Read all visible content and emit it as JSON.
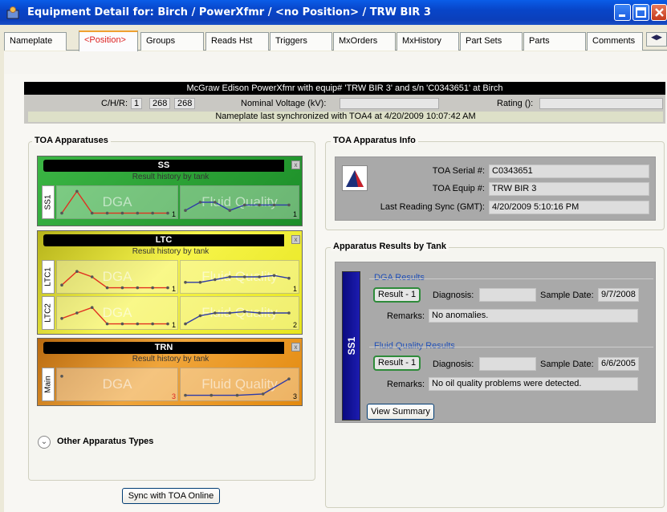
{
  "window": {
    "title": "Equipment Detail for:  Birch / PowerXfmr / <no Position> / TRW BIR 3"
  },
  "tabs": [
    "Nameplate",
    "<Position>",
    "Groups",
    "Reads Hst",
    "Triggers",
    "MxOrders",
    "MxHistory",
    "Part Sets",
    "Parts",
    "Comments"
  ],
  "nameplate": {
    "header": "McGraw Edison PowerXfmr with equip# 'TRW BIR 3' and s/n 'C0343651' at Birch",
    "chr_label": "C/H/R:",
    "chr_values": [
      "1",
      "268",
      "268"
    ],
    "voltage_label": "Nominal Voltage (kV):",
    "voltage_value": "",
    "rating_label": "Rating ():",
    "rating_value": "",
    "sync_text": "Nameplate last synchronized with TOA4 at 4/20/2009 10:07:42 AM"
  },
  "toa_apparatuses": {
    "title": "TOA Apparatuses",
    "subtitle": "Result history by tank",
    "dga_watermark": "DGA",
    "fq_watermark": "Fluid Quality",
    "close": "x",
    "groups": [
      {
        "name": "SS",
        "color": "#1f9c2c",
        "tanks": [
          {
            "label": "SS1",
            "dga_count": "1",
            "fq_count": "1",
            "dga_points": [
              0.9,
              0.1,
              0.9,
              0.9,
              0.9,
              0.9,
              0.9,
              0.9
            ],
            "fq_points": [
              0.8,
              0.5,
              0.5,
              0.8,
              0.6,
              0.6,
              0.6,
              0.6
            ]
          }
        ]
      },
      {
        "name": "LTC",
        "color": "#e2e012",
        "tanks": [
          {
            "label": "LTC1",
            "dga_count": "1",
            "fq_count": "1",
            "dga_points": [
              0.8,
              0.3,
              0.5,
              0.9,
              0.9,
              0.9,
              0.9,
              0.9
            ],
            "fq_points": [
              0.7,
              0.7,
              0.6,
              0.5,
              0.5,
              0.5,
              0.45,
              0.55
            ]
          },
          {
            "label": "LTC2",
            "dga_count": "1",
            "fq_count": "2",
            "dga_points": [
              0.7,
              0.5,
              0.3,
              0.9,
              0.9,
              0.9,
              0.9,
              0.9
            ],
            "fq_points": [
              0.9,
              0.6,
              0.5,
              0.5,
              0.45,
              0.5,
              0.5,
              0.5
            ]
          }
        ]
      },
      {
        "name": "TRN",
        "color": "#e38a0f",
        "tanks": [
          {
            "label": "Main",
            "dga_count": "3",
            "fq_count": "3",
            "dga_points": [
              0.2
            ],
            "fq_points": [
              0.9,
              0.9,
              0.9,
              0.85,
              0.3
            ]
          }
        ]
      }
    ],
    "other_label": "Other Apparatus Types",
    "sync_button": "Sync with TOA Online"
  },
  "apparatus_info": {
    "title": "TOA Apparatus Info",
    "serial_label": "TOA Serial #:",
    "serial_value": "C0343651",
    "equip_label": "TOA Equip #:",
    "equip_value": "TRW BIR 3",
    "sync_label": "Last Reading Sync (GMT):",
    "sync_value": "4/20/2009 5:10:16 PM"
  },
  "results": {
    "title": "Apparatus Results by Tank",
    "tank": "SS1",
    "dga": {
      "heading": "DGA Results",
      "result": "Result - 1",
      "diagnosis_label": "Diagnosis:",
      "diagnosis_value": "",
      "sample_label": "Sample Date:",
      "sample_value": "9/7/2008",
      "remarks_label": "Remarks:",
      "remarks_value": "No anomalies."
    },
    "fq": {
      "heading": "Fluid Quality Results",
      "result": "Result - 1",
      "diagnosis_label": "Diagnosis:",
      "diagnosis_value": "",
      "sample_label": "Sample Date:",
      "sample_value": "6/6/2005",
      "remarks_label": "Remarks:",
      "remarks_value": "No oil quality problems were detected."
    },
    "view_summary": "View Summary"
  },
  "colors": {
    "dga_line": "#e03020",
    "fq_line": "#2d3aa8"
  }
}
